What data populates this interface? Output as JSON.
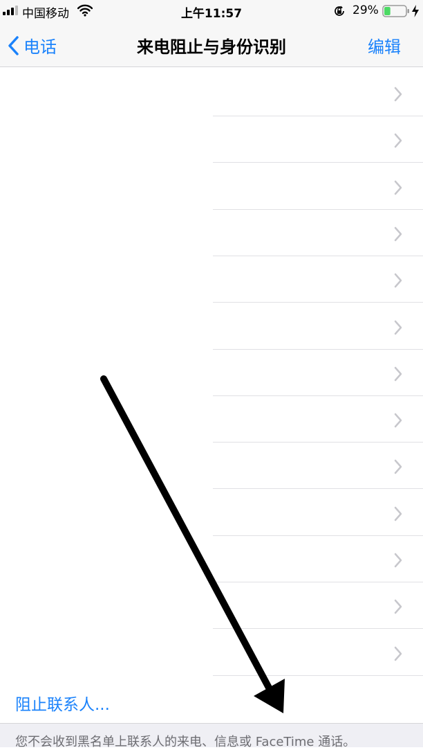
{
  "status_bar": {
    "carrier": "中国移动",
    "time": "上午11:57",
    "battery_percent": "29%",
    "battery_level": 0.29,
    "icons": [
      "signal-icon",
      "wifi-icon",
      "rotation-lock-icon",
      "battery-icon",
      "charging-icon"
    ]
  },
  "nav": {
    "back_label": "电话",
    "title": "来电阻止与身份识别",
    "edit_label": "编辑"
  },
  "blocked_list": {
    "row_count": 13,
    "rows": [
      "",
      "",
      "",
      "",
      "",
      "",
      "",
      "",
      "",
      "",
      "",
      "",
      ""
    ]
  },
  "footer": {
    "block_contact_label": "阻止联系人...",
    "note": "您不会收到黑名单上联系人的来电、信息或 FaceTime 通话。"
  },
  "annotation": {
    "arrow_color": "#000000"
  },
  "colors": {
    "accent": "#1a82fb",
    "background": "#ffffff",
    "footer_background": "#efeff4",
    "battery_fill": "#4cd964"
  }
}
